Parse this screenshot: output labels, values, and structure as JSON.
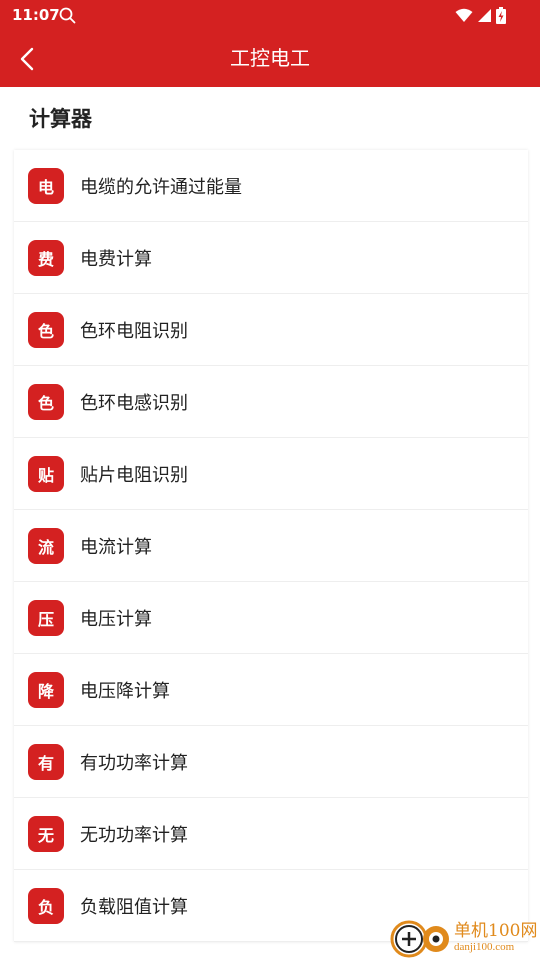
{
  "status_bar": {
    "time": "11:07"
  },
  "app_bar": {
    "title": "工控电工"
  },
  "section": {
    "title": "计算器"
  },
  "items": [
    {
      "badge": "电",
      "label": "电缆的允许通过能量"
    },
    {
      "badge": "费",
      "label": "电费计算"
    },
    {
      "badge": "色",
      "label": "色环电阻识别"
    },
    {
      "badge": "色",
      "label": "色环电感识别"
    },
    {
      "badge": "贴",
      "label": "贴片电阻识别"
    },
    {
      "badge": "流",
      "label": "电流计算"
    },
    {
      "badge": "压",
      "label": "电压计算"
    },
    {
      "badge": "降",
      "label": "电压降计算"
    },
    {
      "badge": "有",
      "label": "有功功率计算"
    },
    {
      "badge": "无",
      "label": "无功功率计算"
    },
    {
      "badge": "负",
      "label": "负载阻值计算"
    }
  ],
  "watermark": {
    "main": "单机100网",
    "sub": "danji100.com"
  },
  "colors": {
    "primary": "#d42121",
    "watermark": "#e08a1c"
  }
}
